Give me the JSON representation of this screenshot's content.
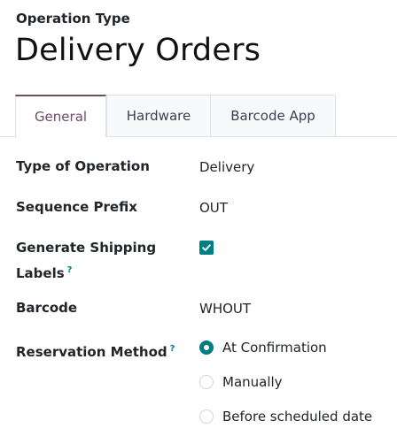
{
  "header": {
    "eyebrow": "Operation Type",
    "title": "Delivery Orders"
  },
  "tabs": [
    {
      "label": "General",
      "active": true
    },
    {
      "label": "Hardware",
      "active": false
    },
    {
      "label": "Barcode App",
      "active": false
    }
  ],
  "form": {
    "type_of_operation": {
      "label": "Type of Operation",
      "value": "Delivery"
    },
    "sequence_prefix": {
      "label": "Sequence Prefix",
      "value": "OUT"
    },
    "generate_shipping_labels": {
      "label_line1": "Generate Shipping",
      "label_line2": "Labels",
      "checked": true
    },
    "barcode": {
      "label": "Barcode",
      "value": "WHOUT"
    },
    "reservation_method": {
      "label": "Reservation Method",
      "options": [
        {
          "label": "At Confirmation",
          "checked": true
        },
        {
          "label": "Manually",
          "checked": false
        },
        {
          "label": "Before scheduled date",
          "checked": false
        }
      ]
    },
    "help_marker": "?"
  },
  "colors": {
    "accent_tab": "#714b67",
    "accent_control": "#017e84"
  }
}
